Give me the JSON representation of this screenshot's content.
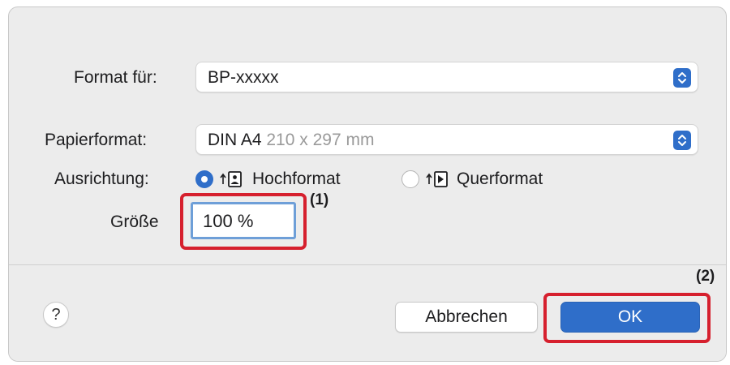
{
  "dialog": {
    "format_for": {
      "label": "Format für:",
      "value": "BP-xxxxx"
    },
    "paper_size": {
      "label": "Papierformat:",
      "value_main": "DIN A4",
      "value_dim": "210 x 297 mm"
    },
    "orientation": {
      "label": "Ausrichtung:",
      "options": [
        {
          "label": "Hochformat",
          "selected": true
        },
        {
          "label": "Querformat",
          "selected": false
        }
      ]
    },
    "scale": {
      "label": "Größe",
      "value": "100 %"
    },
    "help_label": "?",
    "cancel_label": "Abbrechen",
    "ok_label": "OK"
  },
  "annotations": {
    "callout_1": "(1)",
    "callout_2": "(2)",
    "highlight_color": "#d6202e"
  },
  "colors": {
    "accent": "#2f6ec9"
  }
}
